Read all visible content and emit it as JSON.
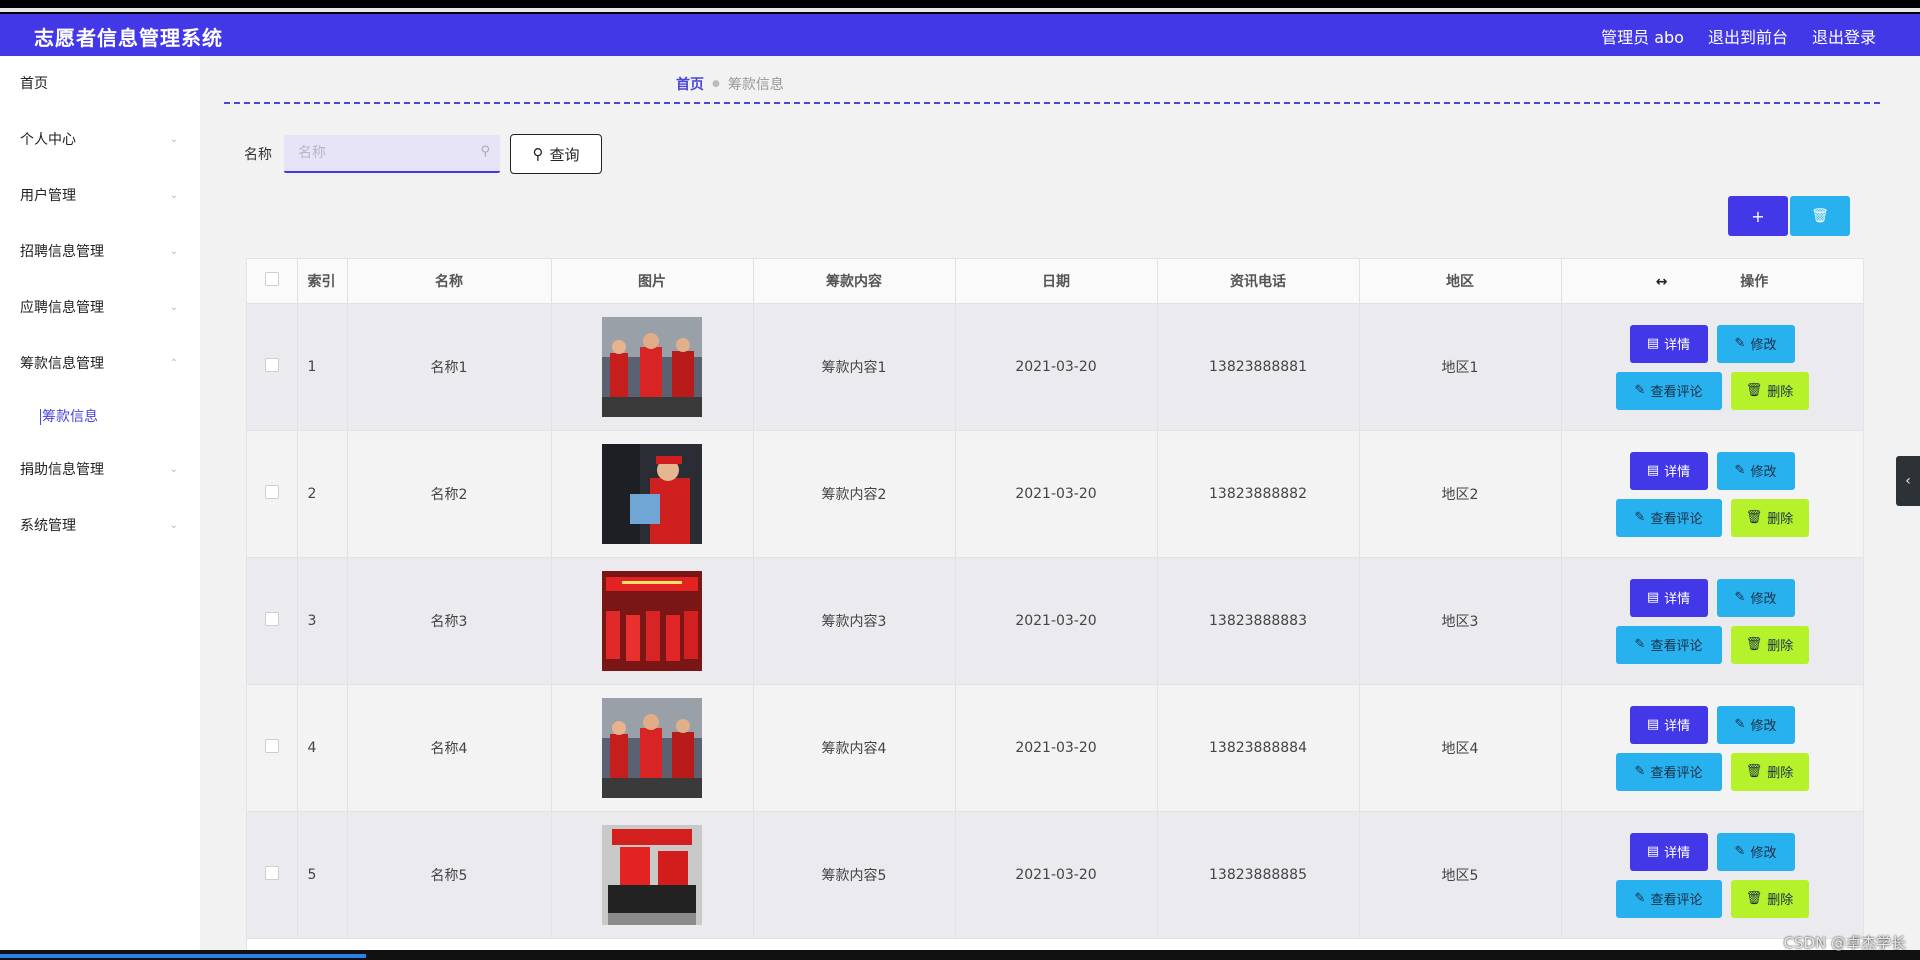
{
  "header": {
    "title": "志愿者信息管理系统",
    "admin": "管理员 abo",
    "exit_front": "退出到前台",
    "logout": "退出登录"
  },
  "sidebar": {
    "items": [
      {
        "label": "首页",
        "chevron": ""
      },
      {
        "label": "个人中心",
        "chevron": "chevron-down"
      },
      {
        "label": "用户管理",
        "chevron": "chevron-down"
      },
      {
        "label": "招聘信息管理",
        "chevron": "chevron-down"
      },
      {
        "label": "应聘信息管理",
        "chevron": "chevron-down"
      },
      {
        "label": "筹款信息管理",
        "chevron": "chevron-up"
      },
      {
        "label": "捐助信息管理",
        "chevron": "chevron-down"
      },
      {
        "label": "系统管理",
        "chevron": "chevron-down"
      }
    ],
    "sub_item": "筹款信息"
  },
  "breadcrumb": {
    "home": "首页",
    "current": "筹款信息"
  },
  "search": {
    "label": "名称",
    "placeholder": "名称",
    "button": "查询"
  },
  "table": {
    "headers": [
      "索引",
      "名称",
      "图片",
      "筹款内容",
      "日期",
      "资讯电话",
      "地区",
      "操作"
    ],
    "rows": [
      {
        "idx": "1",
        "name": "名称1",
        "content": "筹款内容1",
        "date": "2021-03-20",
        "phone": "13823888881",
        "region": "地区1"
      },
      {
        "idx": "2",
        "name": "名称2",
        "content": "筹款内容2",
        "date": "2021-03-20",
        "phone": "13823888882",
        "region": "地区2"
      },
      {
        "idx": "3",
        "name": "名称3",
        "content": "筹款内容3",
        "date": "2021-03-20",
        "phone": "13823888883",
        "region": "地区3"
      },
      {
        "idx": "4",
        "name": "名称4",
        "content": "筹款内容4",
        "date": "2021-03-20",
        "phone": "13823888884",
        "region": "地区4"
      },
      {
        "idx": "5",
        "name": "名称5",
        "content": "筹款内容5",
        "date": "2021-03-20",
        "phone": "13823888885",
        "region": "地区5"
      }
    ],
    "actions": {
      "detail": "详情",
      "edit": "修改",
      "comment": "查看评论",
      "delete": "删除"
    }
  },
  "watermark": "CSDN @卓杰学长",
  "colors": {
    "primary": "#4338e8",
    "info": "#27b1ee",
    "danger": "#b5f22c"
  },
  "icons": {
    "add": "plus-icon",
    "delete_all": "trash-icon",
    "search": "search-icon",
    "side_handle": "chevron-left-icon"
  }
}
